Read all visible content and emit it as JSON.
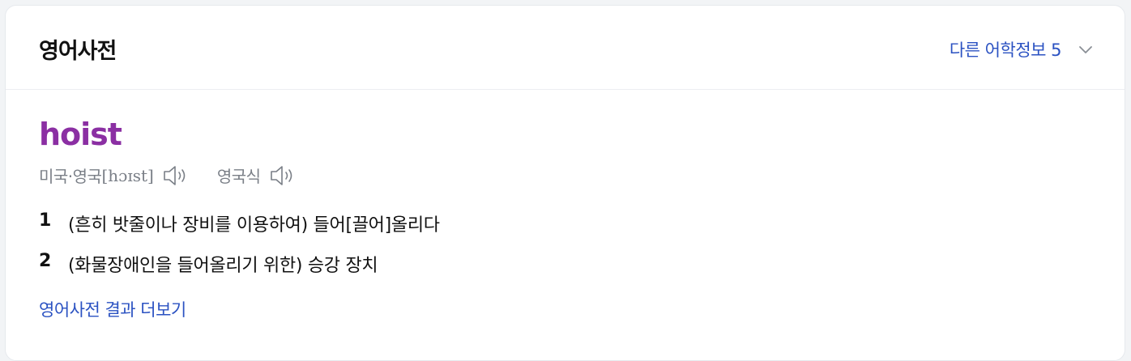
{
  "header": {
    "title": "영어사전",
    "more_info_label": "다른 어학정보 5",
    "more_info_icon": "chevron-down-icon"
  },
  "entry": {
    "word": "hoist",
    "pronunciations": [
      {
        "label": "미국·영국",
        "ipa": "[hɔɪst]",
        "icon": "speaker-icon"
      },
      {
        "label": "영국식",
        "ipa": "",
        "icon": "speaker-icon"
      }
    ],
    "meanings": [
      {
        "num": "1",
        "text": "(흔히 밧줄이나 장비를 이용하여) 들어[끌어]올리다"
      },
      {
        "num": "2",
        "text": "(화물장애인을 들어올리기 위한) 승강 장치"
      }
    ]
  },
  "footer": {
    "more_link": "영어사전 결과 더보기"
  },
  "colors": {
    "headword": "#8b2fa3",
    "link": "#2b52c2",
    "muted": "#7a7f87"
  }
}
